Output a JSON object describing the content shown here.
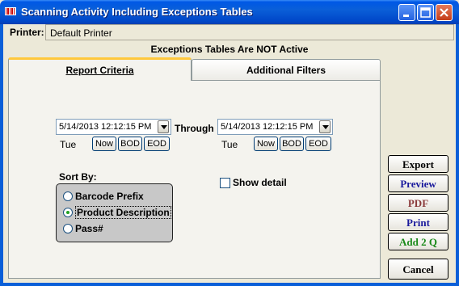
{
  "window": {
    "title": "Scanning Activity Including Exceptions Tables",
    "icon": "barcode-scanner-icon"
  },
  "printer": {
    "label": "Printer:",
    "value": "Default Printer"
  },
  "status": {
    "exceptions_text": "Exceptions Tables Are  NOT Active"
  },
  "tabs": [
    {
      "label": "Report Criteria",
      "active": true
    },
    {
      "label": "Additional Filters",
      "active": false
    }
  ],
  "criteria": {
    "from": {
      "datetime": "5/14/2013 12:12:15 PM",
      "day": "Tue"
    },
    "through_label": "Through",
    "to": {
      "datetime": "5/14/2013 12:12:15 PM",
      "day": "Tue"
    },
    "buttons": {
      "now": "Now",
      "bod": "BOD",
      "eod": "EOD"
    },
    "sort_by": {
      "label": "Sort By:",
      "options": [
        "Barcode Prefix",
        "Product Description",
        "Pass#"
      ],
      "selected": "Product Description"
    },
    "show_detail": {
      "label": "Show detail",
      "checked": false
    }
  },
  "actions": {
    "export": "Export",
    "preview": "Preview",
    "pdf": "PDF",
    "print": "Print",
    "add2q": "Add 2 Q",
    "cancel": "Cancel"
  },
  "colors": {
    "title_bar": "#0a5fd8",
    "preview_text": "#1a1a9c",
    "pdf_text": "#8a3a3a",
    "print_text": "#1a1a9c",
    "add2q_text": "#1a8a1a",
    "tab_highlight": "#ffc83c"
  }
}
